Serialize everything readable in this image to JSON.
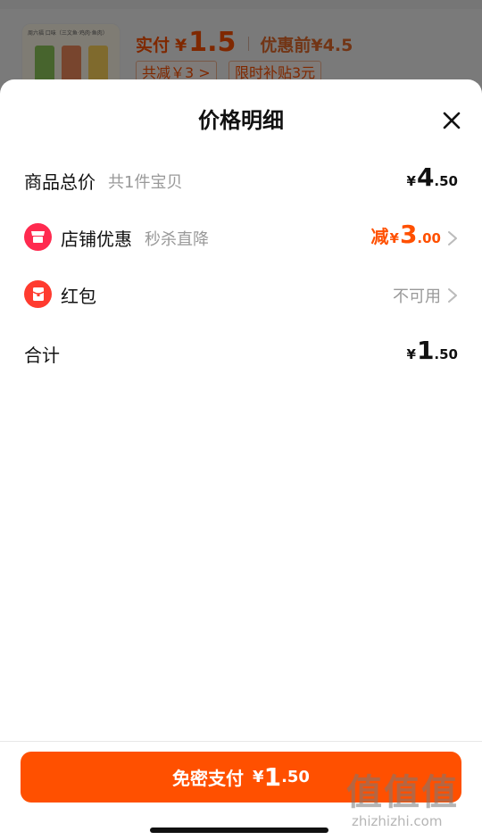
{
  "background_card": {
    "thumb_header": "周六福 口味（三文鱼·鸡肉·鱼肉）",
    "price_label": "实付",
    "currency": "¥",
    "price": "1.5",
    "orig_label": "优惠前",
    "orig_price": "¥4.5",
    "tag_discount": "共减￥3 >",
    "tag_subsidy": "限时补贴3元"
  },
  "sheet": {
    "title": "价格明细",
    "rows": {
      "subtotal": {
        "label": "商品总价",
        "sub": "共1件宝贝",
        "currency": "¥",
        "int": "4",
        "dec": ".50"
      },
      "store_discount": {
        "label": "店铺优惠",
        "sub": "秒杀直降",
        "prefix": "减",
        "currency": "¥",
        "int": "3",
        "dec": ".00",
        "icon": "store-icon"
      },
      "red_packet": {
        "label": "红包",
        "status": "不可用",
        "icon": "red-packet-icon"
      },
      "total": {
        "label": "合计",
        "currency": "¥",
        "int": "1",
        "dec": ".50"
      }
    }
  },
  "pay_button": {
    "label": "免密支付",
    "currency": "¥",
    "int": "1",
    "dec": ".50"
  },
  "watermark": {
    "big": "值值值",
    "small": "zhizhizhi.com"
  },
  "colors": {
    "accent": "#ff5000",
    "icon_pink": "#ff2a4f",
    "muted": "#999999"
  }
}
